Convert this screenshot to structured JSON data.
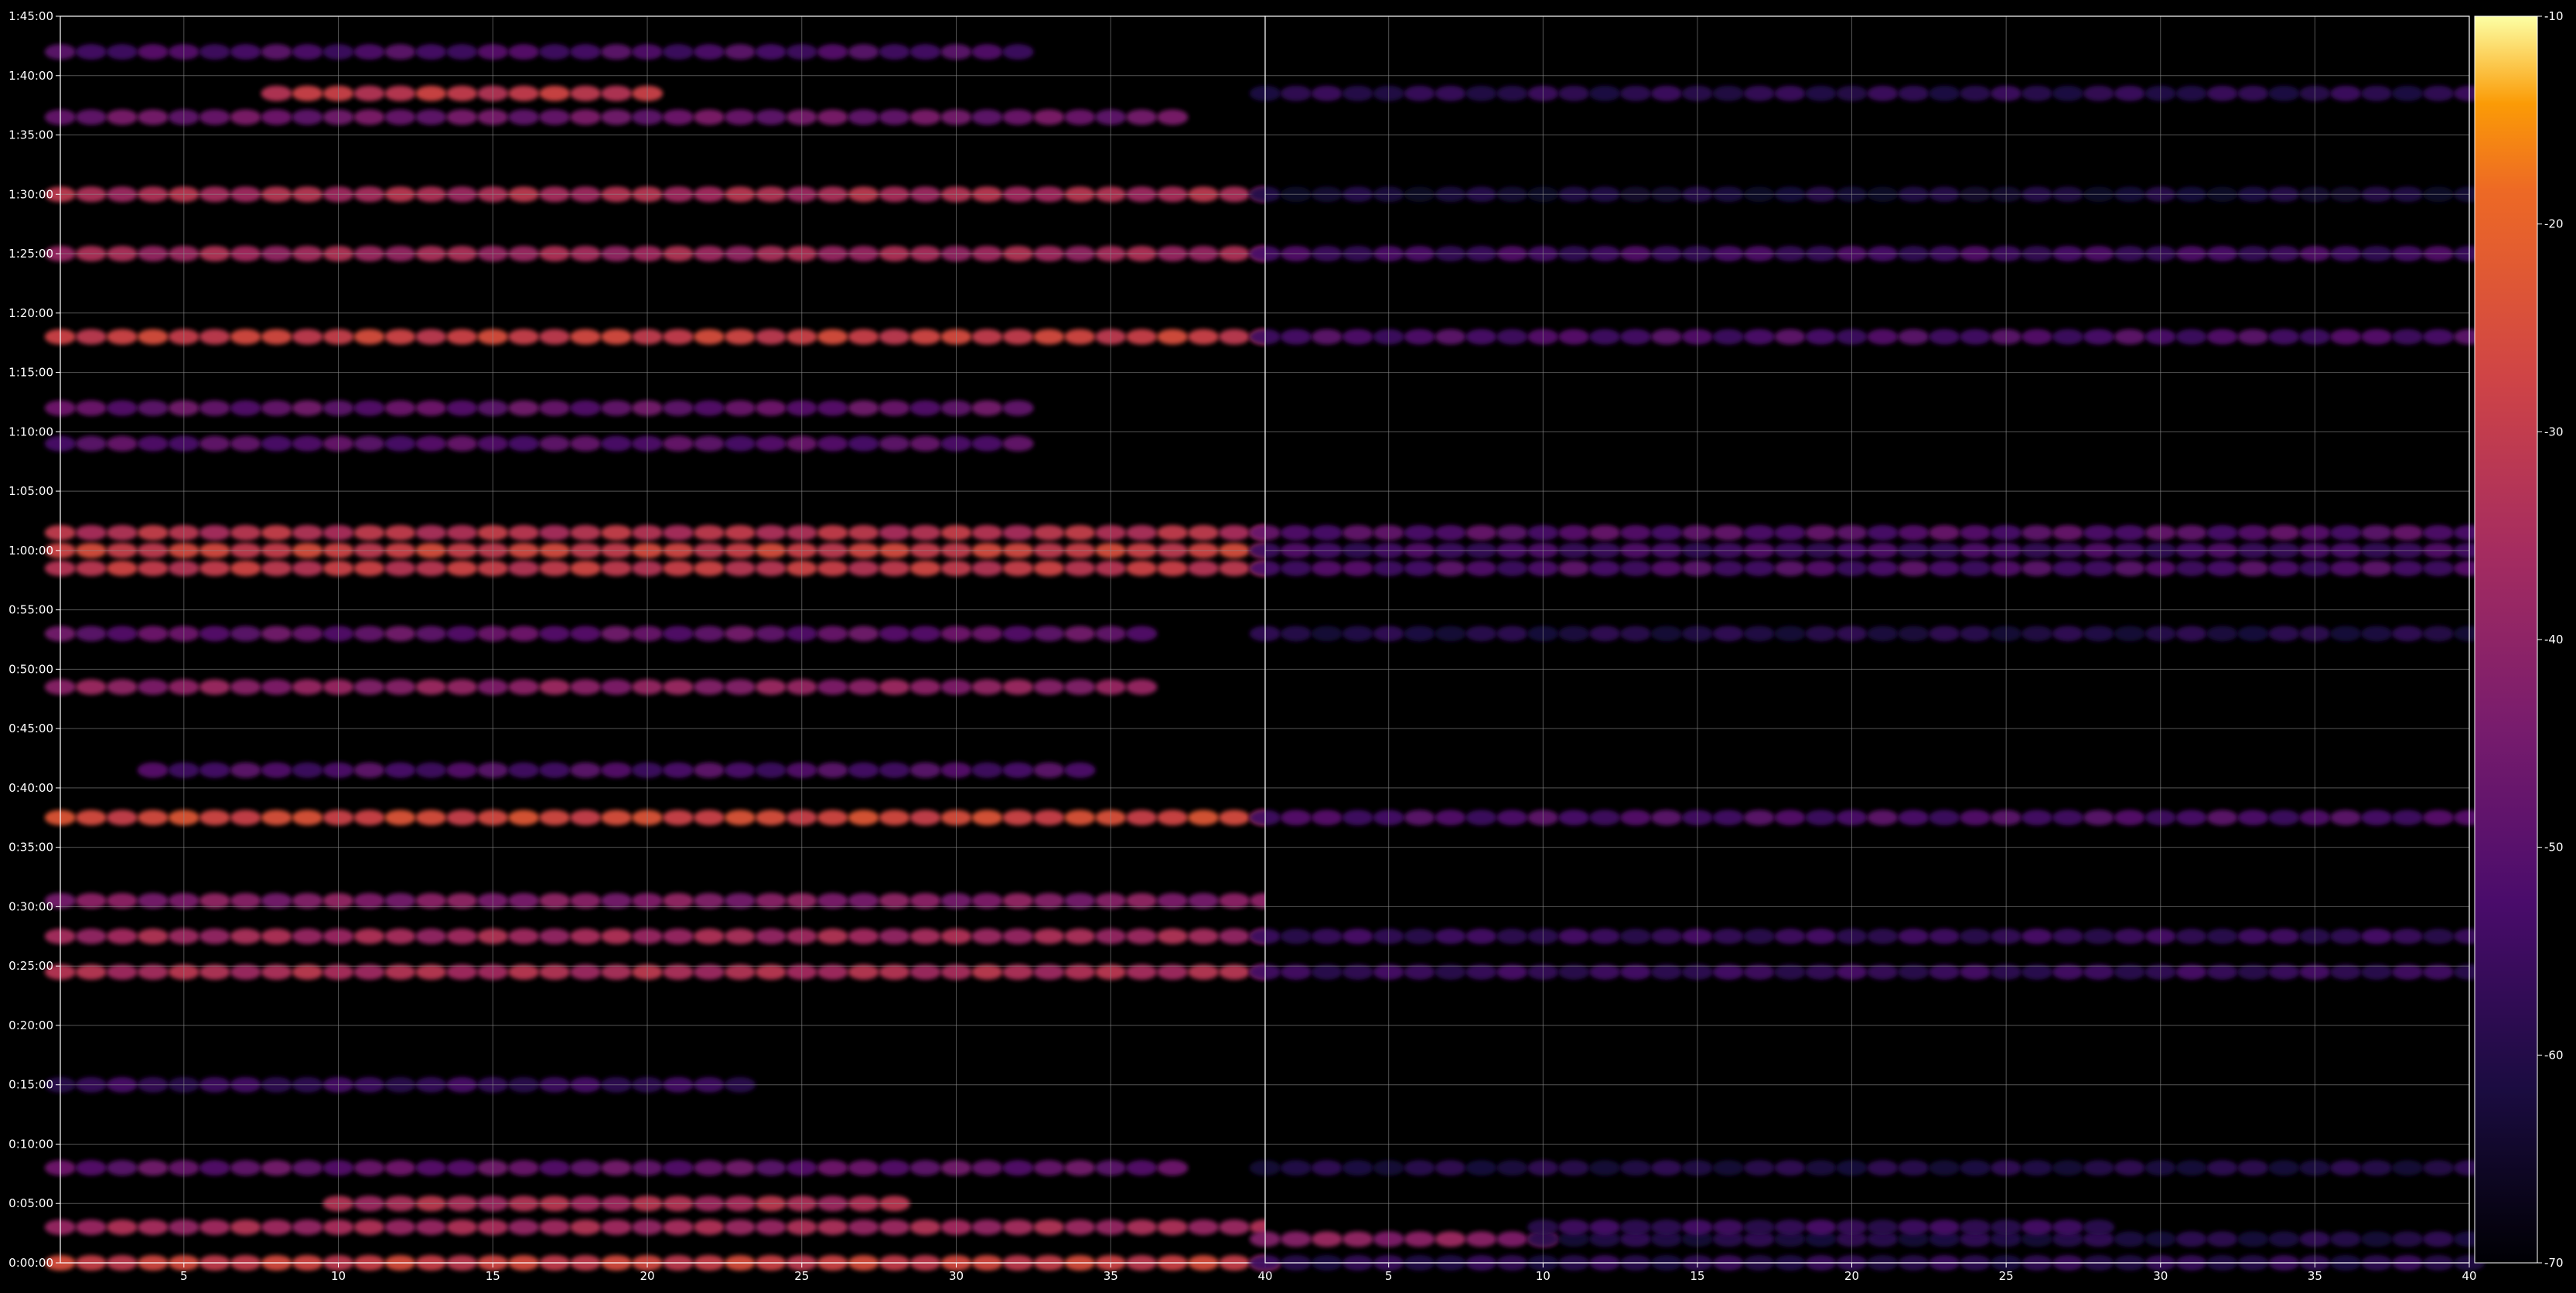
{
  "chart_data": {
    "type": "heatmap",
    "title": "",
    "grid": true,
    "panels": [
      {
        "name": "",
        "x_ticks": [
          "5",
          "10",
          "15",
          "20",
          "25",
          "30",
          "35",
          "40"
        ],
        "x_tick_values": [
          5,
          10,
          15,
          20,
          25,
          30,
          35,
          40
        ],
        "xlim": [
          1,
          40
        ],
        "ylim_seconds": [
          0,
          6300
        ],
        "y_ticks": [
          "0:00:00",
          "0:05:00",
          "0:10:00",
          "0:15:00",
          "0:20:00",
          "0:25:00",
          "0:30:00",
          "0:35:00",
          "0:40:00",
          "0:45:00",
          "0:50:00",
          "0:55:00",
          "1:00:00",
          "1:05:00",
          "1:10:00",
          "1:15:00",
          "1:20:00",
          "1:25:00",
          "1:30:00",
          "1:35:00",
          "1:40:00",
          "1:45:00"
        ],
        "bands": [
          {
            "time": "0:00:00",
            "x_range": [
              1,
              40
            ],
            "value": -28
          },
          {
            "time": "0:03:00",
            "x_range": [
              1,
              40
            ],
            "value": -36
          },
          {
            "time": "0:05:00",
            "x_range": [
              10,
              28
            ],
            "value": -34
          },
          {
            "time": "0:08:00",
            "x_range": [
              1,
              37
            ],
            "value": -48
          },
          {
            "time": "0:15:00",
            "x_range": [
              1,
              23
            ],
            "value": -56
          },
          {
            "time": "0:24:30",
            "x_range": [
              1,
              40
            ],
            "value": -34
          },
          {
            "time": "0:27:30",
            "x_range": [
              1,
              40
            ],
            "value": -36
          },
          {
            "time": "0:30:30",
            "x_range": [
              1,
              40
            ],
            "value": -42
          },
          {
            "time": "0:37:30",
            "x_range": [
              1,
              40
            ],
            "value": -26
          },
          {
            "time": "0:41:30",
            "x_range": [
              4,
              34
            ],
            "value": -52
          },
          {
            "time": "0:48:30",
            "x_range": [
              1,
              36
            ],
            "value": -40
          },
          {
            "time": "0:53:00",
            "x_range": [
              1,
              36
            ],
            "value": -48
          },
          {
            "time": "0:58:30",
            "x_range": [
              1,
              40
            ],
            "value": -30
          },
          {
            "time": "1:00:00",
            "x_range": [
              1,
              40
            ],
            "value": -28
          },
          {
            "time": "1:01:30",
            "x_range": [
              1,
              40
            ],
            "value": -32
          },
          {
            "time": "1:09:00",
            "x_range": [
              1,
              32
            ],
            "value": -50
          },
          {
            "time": "1:12:00",
            "x_range": [
              1,
              32
            ],
            "value": -48
          },
          {
            "time": "1:18:00",
            "x_range": [
              1,
              40
            ],
            "value": -28
          },
          {
            "time": "1:25:00",
            "x_range": [
              1,
              40
            ],
            "value": -36
          },
          {
            "time": "1:30:00",
            "x_range": [
              1,
              40
            ],
            "value": -34
          },
          {
            "time": "1:36:30",
            "x_range": [
              1,
              37
            ],
            "value": -46
          },
          {
            "time": "1:38:30",
            "x_range": [
              8,
              20
            ],
            "value": -30
          },
          {
            "time": "1:42:00",
            "x_range": [
              1,
              32
            ],
            "value": -52
          }
        ]
      },
      {
        "name": "",
        "x_ticks": [
          "5",
          "10",
          "15",
          "20",
          "25",
          "30",
          "35",
          "40"
        ],
        "x_tick_values": [
          5,
          10,
          15,
          20,
          25,
          30,
          35,
          40
        ],
        "xlim": [
          1,
          40
        ],
        "ylim_seconds": [
          0,
          6300
        ],
        "bands": [
          {
            "time": "0:00:00",
            "x_range": [
              1,
              40
            ],
            "value": -58
          },
          {
            "time": "0:02:00",
            "x_range": [
              1,
              10
            ],
            "value": -40
          },
          {
            "time": "0:02:00",
            "x_range": [
              10,
              40
            ],
            "value": -60
          },
          {
            "time": "0:03:00",
            "x_range": [
              10,
              28
            ],
            "value": -56
          },
          {
            "time": "0:08:00",
            "x_range": [
              1,
              40
            ],
            "value": -60
          },
          {
            "time": "0:24:30",
            "x_range": [
              1,
              40
            ],
            "value": -56
          },
          {
            "time": "0:27:30",
            "x_range": [
              1,
              40
            ],
            "value": -56
          },
          {
            "time": "0:37:30",
            "x_range": [
              1,
              40
            ],
            "value": -52
          },
          {
            "time": "0:53:00",
            "x_range": [
              1,
              40
            ],
            "value": -60
          },
          {
            "time": "0:58:30",
            "x_range": [
              1,
              40
            ],
            "value": -52
          },
          {
            "time": "1:00:00",
            "x_range": [
              1,
              40
            ],
            "value": -54
          },
          {
            "time": "1:01:30",
            "x_range": [
              1,
              40
            ],
            "value": -50
          },
          {
            "time": "1:18:00",
            "x_range": [
              1,
              40
            ],
            "value": -52
          },
          {
            "time": "1:25:00",
            "x_range": [
              1,
              40
            ],
            "value": -54
          },
          {
            "time": "1:30:00",
            "x_range": [
              1,
              40
            ],
            "value": -62
          },
          {
            "time": "1:38:30",
            "x_range": [
              1,
              40
            ],
            "value": -58
          }
        ]
      }
    ],
    "colorbar": {
      "colormap": "inferno",
      "range": [
        -70,
        -10
      ],
      "ticks": [
        "-10",
        "-20",
        "-30",
        "-40",
        "-50",
        "-60",
        "-70"
      ],
      "tick_values": [
        -10,
        -20,
        -30,
        -40,
        -50,
        -60,
        -70
      ]
    },
    "colors": {
      "background": "#000000",
      "grid": "#8c8c8c",
      "axis": "#ffffff",
      "text": "#ffffff"
    }
  }
}
